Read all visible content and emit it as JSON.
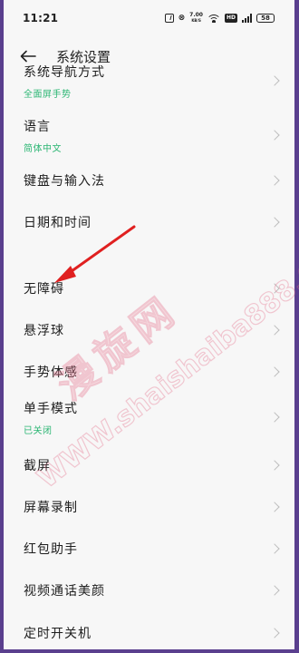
{
  "status": {
    "time": "11:21",
    "net_speed": "7.00",
    "net_unit": "KB/S",
    "battery": "58",
    "hd": "HD"
  },
  "header": {
    "title": "系统设置"
  },
  "items": [
    {
      "title": "系统导航方式",
      "subtitle": "全面屏手势"
    },
    {
      "title": "语言",
      "subtitle": "简体中文"
    },
    {
      "title": "键盘与输入法",
      "subtitle": ""
    },
    {
      "title": "日期和时间",
      "subtitle": ""
    },
    {
      "title": "无障碍",
      "subtitle": ""
    },
    {
      "title": "悬浮球",
      "subtitle": ""
    },
    {
      "title": "手势体感",
      "subtitle": ""
    },
    {
      "title": "单手模式",
      "subtitle": "已关闭"
    },
    {
      "title": "截屏",
      "subtitle": ""
    },
    {
      "title": "屏幕录制",
      "subtitle": ""
    },
    {
      "title": "红包助手",
      "subtitle": ""
    },
    {
      "title": "视频通话美颜",
      "subtitle": ""
    },
    {
      "title": "定时开关机",
      "subtitle": ""
    }
  ],
  "watermark": {
    "cn": "漫旋网",
    "url": "WWW.shaishaiba888.Com"
  },
  "colors": {
    "accent_green": "#2bb673",
    "arrow_red": "#e02020",
    "frame_purple": "#5a3f8e"
  }
}
